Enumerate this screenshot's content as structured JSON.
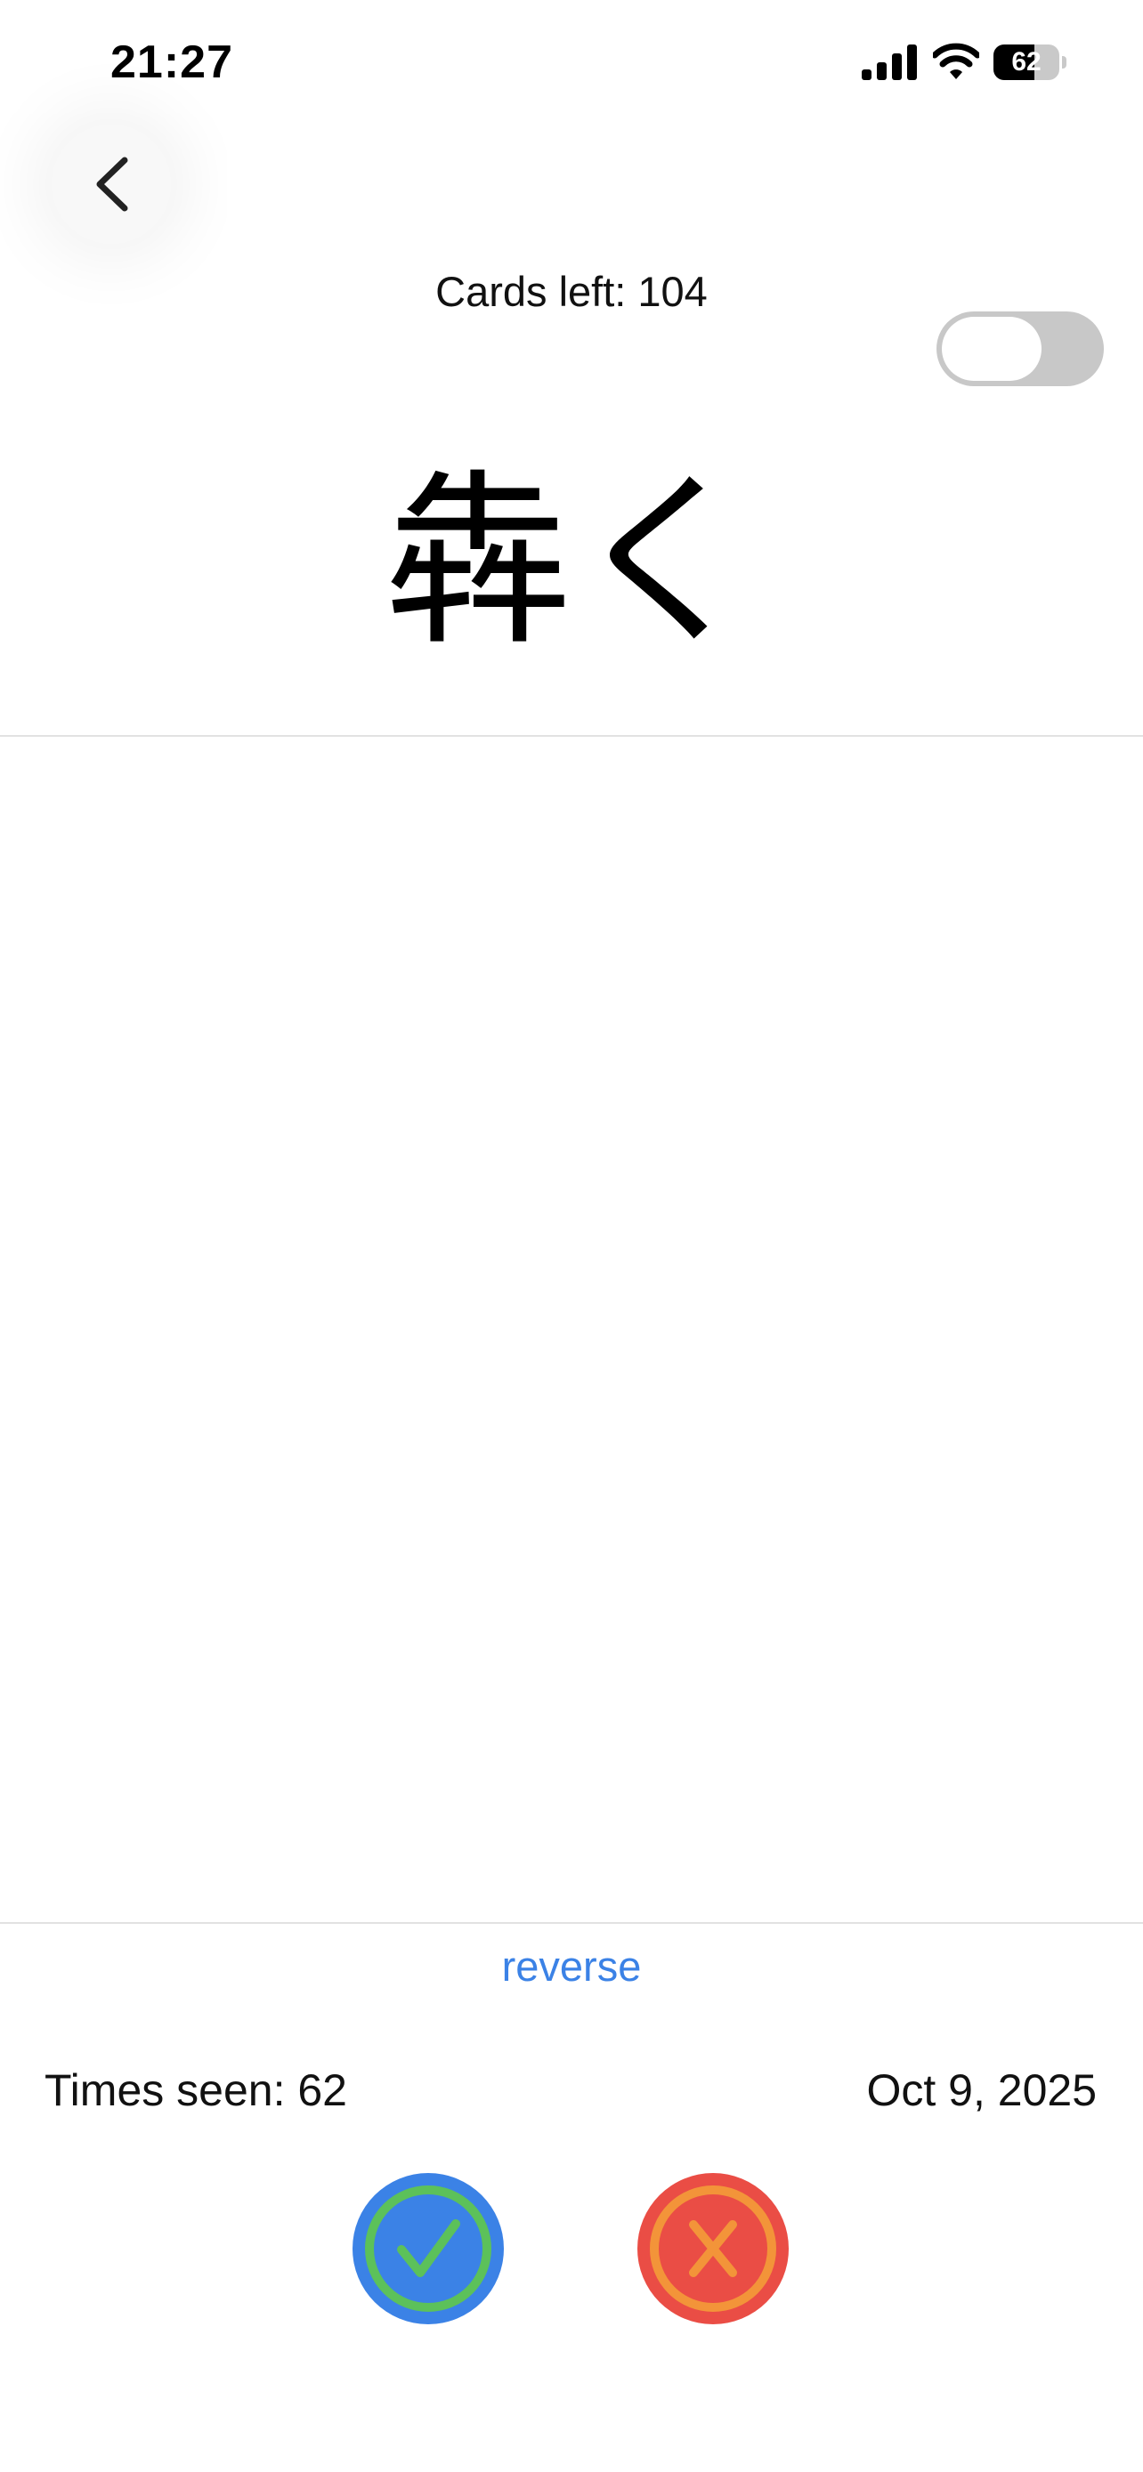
{
  "status_bar": {
    "time": "21:27",
    "battery_level": "62",
    "battery_fraction": 0.62,
    "icons": [
      "signal-icon",
      "wifi-icon",
      "battery-icon"
    ]
  },
  "header": {
    "back_icon": "chevron-left-icon",
    "cards_left": "Cards left: 104",
    "toggle_on": false
  },
  "card": {
    "term": "犇く",
    "reverse_label": "reverse"
  },
  "stats": {
    "times_seen": "Times seen: 62",
    "date": "Oct 9, 2025"
  },
  "actions": {
    "correct_icon": "check-icon",
    "wrong_icon": "x-icon"
  },
  "colors": {
    "accent": "#3b82e6",
    "correct_ring": "#5cc15a",
    "wrong_fill": "#ea4d45",
    "wrong_ring": "#f39439",
    "toggle_off": "#c8c8c8"
  }
}
